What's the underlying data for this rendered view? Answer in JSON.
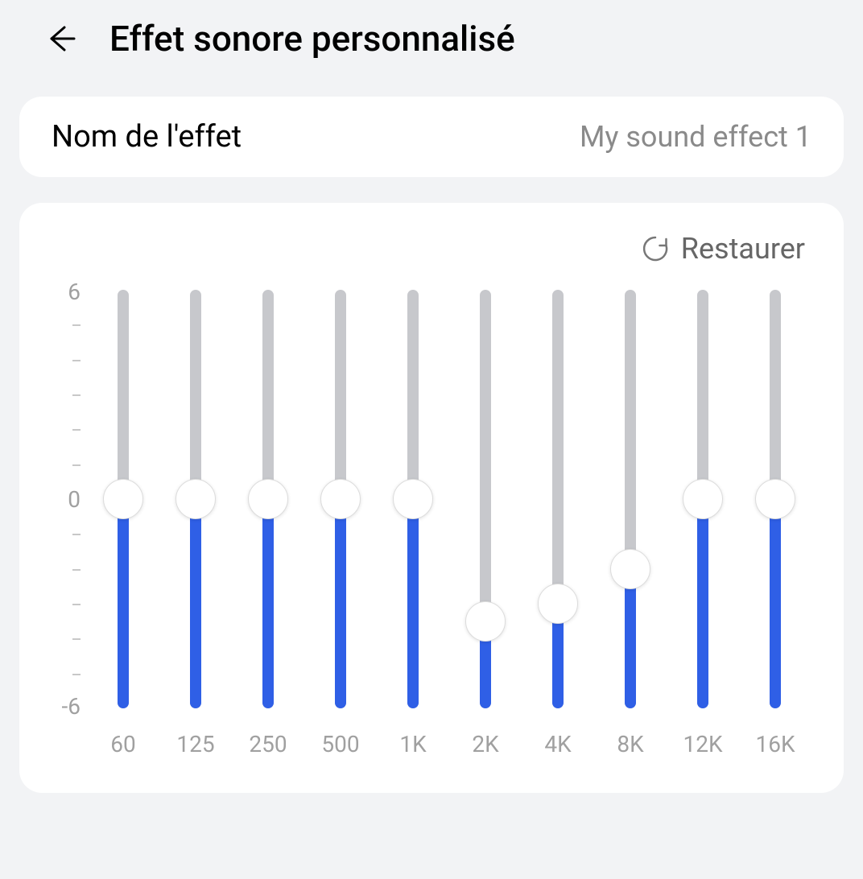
{
  "header": {
    "title": "Effet sonore personnalisé"
  },
  "effect_name": {
    "label": "Nom de l'effet",
    "value": "My sound effect 1"
  },
  "equalizer": {
    "restore_label": "Restaurer",
    "y_min": -6,
    "y_zero": 0,
    "y_max": 6,
    "bands": [
      {
        "label": "60",
        "value": 0
      },
      {
        "label": "125",
        "value": 0
      },
      {
        "label": "250",
        "value": 0
      },
      {
        "label": "500",
        "value": 0
      },
      {
        "label": "1K",
        "value": 0
      },
      {
        "label": "2K",
        "value": -3.5
      },
      {
        "label": "4K",
        "value": -3
      },
      {
        "label": "8K",
        "value": -2
      },
      {
        "label": "12K",
        "value": 0
      },
      {
        "label": "16K",
        "value": 0
      }
    ]
  },
  "chart_data": {
    "type": "bar",
    "categories": [
      "60",
      "125",
      "250",
      "500",
      "1K",
      "2K",
      "4K",
      "8K",
      "12K",
      "16K"
    ],
    "values": [
      0,
      0,
      0,
      0,
      0,
      -3.5,
      -3,
      -2,
      0,
      0
    ],
    "title": "Effet sonore personnalisé",
    "xlabel": "",
    "ylabel": "",
    "ylim": [
      -6,
      6
    ]
  }
}
